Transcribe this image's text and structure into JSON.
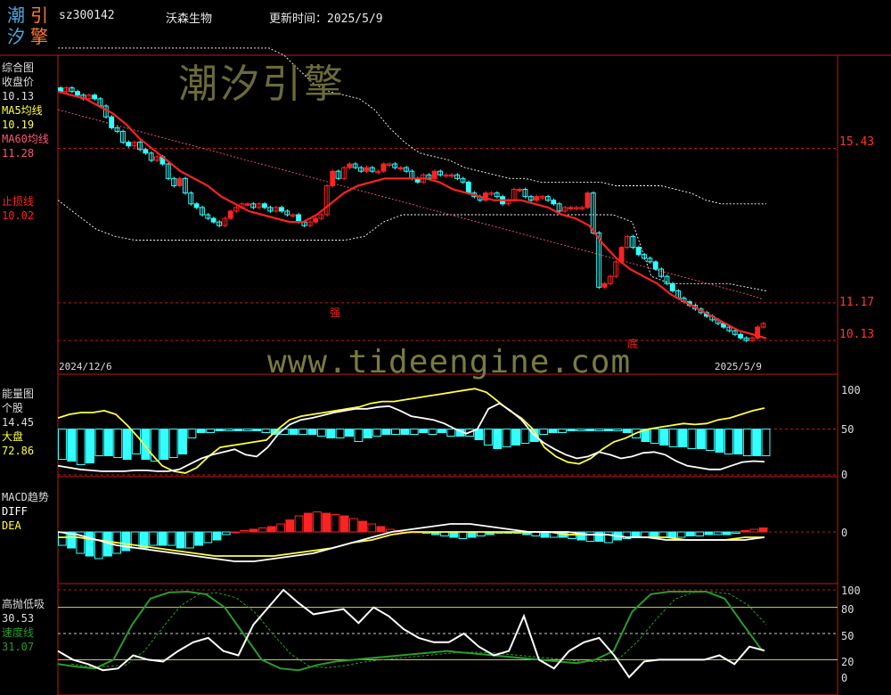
{
  "header": {
    "logo_chars": [
      "潮",
      "引",
      "汐",
      "擎"
    ],
    "code": "sz300142",
    "name": "沃森生物",
    "update_label": "更新时间：2025/5/9"
  },
  "watermark": {
    "brand": "潮汐引擎",
    "url": "www.tideengine.com"
  },
  "panel1": {
    "title": "综合图",
    "close_label": "收盘价",
    "close_value": "10.13",
    "ma5_label": "MA5均线",
    "ma5_value": "10.19",
    "ma60_label": "MA60均线",
    "ma60_value": "11.28",
    "stop_label": "止损线",
    "stop_value": "10.02",
    "right_ticks": [
      "15.43",
      "11.17",
      "10.13"
    ],
    "date_start": "2024/12/6",
    "date_end": "2025/5/9",
    "marker_strong": "强",
    "marker_bottom": "底"
  },
  "panel2": {
    "title": "能量图",
    "stock_label": "个股",
    "stock_value": "14.45",
    "market_label": "大盘",
    "market_value": "72.86",
    "right_ticks": [
      "100",
      "50",
      "0"
    ]
  },
  "panel3": {
    "title": "MACD趋势",
    "diff_label": "DIFF",
    "dea_label": "DEA",
    "right_ticks": [
      "0"
    ]
  },
  "panel4": {
    "title": "高抛低吸",
    "value1": "30.53",
    "speed_label": "速度线",
    "speed_value": "31.07",
    "right_ticks": [
      "100",
      "80",
      "50",
      "20",
      "0"
    ]
  },
  "colors": {
    "cyan": "#33ffff",
    "red": "#ff2222",
    "yellow": "#ffff44",
    "white": "#ffffff",
    "green": "#2a9a2a",
    "pink": "#ff5577",
    "grid": "#c01818"
  },
  "chart_data": [
    {
      "type": "line",
      "title": "综合图",
      "x": [
        "2024/12/6",
        "2025/5/9"
      ],
      "series": [
        {
          "name": "收盘价",
          "values": [
            17.0,
            17.1,
            17.0,
            16.9,
            16.8,
            16.9,
            16.8,
            16.6,
            16.3,
            16.0,
            15.9,
            15.6,
            15.5,
            15.6,
            15.4,
            15.3,
            15.1,
            15.2,
            15.0,
            14.6,
            14.4,
            14.6,
            14.2,
            13.9,
            13.8,
            13.6,
            13.5,
            13.4,
            13.3,
            13.5,
            13.7,
            13.8,
            13.9,
            13.9,
            13.8,
            13.9,
            13.8,
            13.7,
            13.8,
            13.7,
            13.6,
            13.6,
            13.4,
            13.3,
            13.4,
            13.5,
            13.6,
            14.4,
            14.8,
            14.6,
            14.9,
            15.0,
            14.9,
            14.8,
            14.9,
            14.8,
            14.8,
            15.0,
            15.0,
            14.9,
            14.9,
            14.8,
            14.6,
            14.5,
            14.7,
            14.6,
            14.8,
            14.7,
            14.7,
            14.7,
            14.6,
            14.5,
            14.2,
            14.1,
            14.0,
            14.2,
            14.2,
            14.1,
            13.9,
            14.0,
            14.3,
            14.3,
            14.1,
            14.0,
            14.1,
            14.1,
            14.0,
            13.9,
            13.7,
            13.8,
            13.8,
            13.8,
            13.8,
            14.2,
            13.1,
            11.6,
            11.7,
            11.9,
            12.3,
            12.7,
            13.0,
            12.7,
            12.5,
            12.4,
            12.3,
            12.1,
            11.9,
            11.7,
            11.5,
            11.3,
            11.2,
            11.1,
            11.0,
            10.9,
            10.8,
            10.7,
            10.6,
            10.5,
            10.4,
            10.3,
            10.2,
            10.13,
            10.2,
            10.5,
            10.6
          ]
        },
        {
          "name": "MA5均线",
          "values": [
            17.0,
            16.9,
            16.8,
            16.6,
            16.4,
            16.1,
            15.7,
            15.4,
            15.1,
            14.8,
            14.6,
            14.4,
            14.1,
            13.9,
            13.7,
            13.6,
            13.5,
            13.4,
            13.4,
            13.6,
            13.9,
            14.2,
            14.4,
            14.5,
            14.6,
            14.6,
            14.6,
            14.6,
            14.5,
            14.3,
            14.2,
            14.1,
            14.0,
            14.0,
            14.0,
            13.9,
            13.8,
            13.6,
            13.5,
            13.3,
            12.8,
            12.4,
            12.1,
            11.9,
            11.7,
            11.4,
            11.2,
            11.0,
            10.8,
            10.6,
            10.4,
            10.3,
            10.19
          ]
        },
        {
          "name": "MA60均线",
          "values": [
            16.5,
            16.4,
            16.3,
            16.2,
            16.1,
            16.0,
            15.9,
            15.8,
            15.7,
            15.6,
            15.5,
            15.4,
            15.3,
            15.2,
            15.1,
            15.0,
            14.9,
            14.8,
            14.7,
            14.6,
            14.5,
            14.4,
            14.3,
            14.2,
            14.1,
            14.0,
            13.9,
            13.8,
            13.7,
            13.6,
            13.5,
            13.4,
            13.3,
            13.2,
            13.1,
            13.0,
            12.9,
            12.8,
            12.7,
            12.6,
            12.5,
            12.4,
            12.3,
            12.2,
            12.1,
            12.0,
            11.9,
            11.8,
            11.7,
            11.6,
            11.5,
            11.4,
            11.28
          ]
        },
        {
          "name": "止损线",
          "values": [
            10.02
          ]
        }
      ],
      "ylim": [
        9.2,
        18.0
      ]
    },
    {
      "type": "line",
      "title": "能量图",
      "series": [
        {
          "name": "个股",
          "values": [
            10,
            8,
            6,
            5,
            4,
            4,
            4,
            5,
            5,
            4,
            4,
            6,
            12,
            18,
            22,
            25,
            28,
            22,
            20,
            30,
            45,
            55,
            60,
            62,
            65,
            68,
            70,
            72,
            72,
            74,
            75,
            70,
            64,
            62,
            60,
            56,
            50,
            45,
            50,
            72,
            78,
            70,
            60,
            45,
            35,
            28,
            22,
            18,
            20,
            25,
            22,
            18,
            20,
            24,
            25,
            22,
            15,
            10,
            8,
            6,
            6,
            10,
            14,
            15,
            14.45
          ]
        },
        {
          "name": "大盘",
          "values": [
            62,
            66,
            68,
            68,
            70,
            66,
            54,
            40,
            24,
            10,
            4,
            2,
            8,
            20,
            30,
            32,
            34,
            36,
            38,
            50,
            60,
            64,
            66,
            68,
            70,
            72,
            74,
            78,
            80,
            80,
            82,
            84,
            86,
            88,
            90,
            92,
            94,
            90,
            80,
            70,
            62,
            50,
            30,
            20,
            14,
            12,
            18,
            28,
            36,
            40,
            46,
            50,
            52,
            54,
            56,
            55,
            56,
            60,
            62,
            66,
            70,
            72.86
          ]
        }
      ],
      "ylim": [
        0,
        100
      ]
    },
    {
      "type": "bar",
      "title": "MACD趋势",
      "series": [
        {
          "name": "DIFF",
          "values": [
            0.0,
            -0.1,
            -0.3,
            -0.5,
            -0.6,
            -0.7,
            -0.8,
            -0.9,
            -1.0,
            -1.1,
            -1.1,
            -1.0,
            -0.9,
            -0.8,
            -0.6,
            -0.4,
            -0.2,
            0.0,
            0.1,
            0.2,
            0.3,
            0.3,
            0.2,
            0.1,
            0.0,
            0.0,
            0.0,
            -0.1,
            -0.1,
            -0.2,
            -0.2,
            -0.3,
            -0.3,
            -0.3,
            -0.3,
            -0.3,
            -0.2
          ]
        },
        {
          "name": "DEA",
          "values": [
            -0.2,
            -0.2,
            -0.3,
            -0.4,
            -0.5,
            -0.6,
            -0.7,
            -0.8,
            -0.9,
            -0.9,
            -0.9,
            -0.9,
            -0.8,
            -0.7,
            -0.6,
            -0.4,
            -0.3,
            -0.1,
            0.0,
            0.0,
            0.0,
            0.0,
            0.0,
            0.0,
            0.0,
            0.0,
            -0.1,
            -0.1,
            -0.1,
            -0.2,
            -0.2,
            -0.2,
            -0.3,
            -0.3,
            -0.3,
            -0.2,
            -0.2
          ]
        }
      ],
      "ylim": [
        -1.5,
        1.5
      ]
    },
    {
      "type": "line",
      "title": "高抛低吸",
      "series": [
        {
          "name": "高抛低吸",
          "values": [
            30,
            20,
            15,
            8,
            10,
            25,
            20,
            18,
            30,
            40,
            45,
            30,
            25,
            60,
            80,
            100,
            85,
            72,
            75,
            78,
            62,
            80,
            70,
            55,
            45,
            40,
            40,
            50,
            35,
            25,
            30,
            70,
            20,
            10,
            30,
            40,
            45,
            25,
            0,
            18,
            20,
            20,
            20,
            20,
            25,
            15,
            35,
            30.53
          ]
        },
        {
          "name": "速度线",
          "values": [
            15,
            12,
            10,
            20,
            60,
            90,
            97,
            98,
            95,
            80,
            50,
            20,
            10,
            8,
            14,
            18,
            20,
            22,
            24,
            26,
            28,
            30,
            28,
            26,
            24,
            22,
            20,
            18,
            16,
            20,
            30,
            75,
            95,
            98,
            98,
            98,
            90,
            60,
            31.07
          ]
        }
      ],
      "ylim": [
        0,
        100
      ]
    }
  ]
}
